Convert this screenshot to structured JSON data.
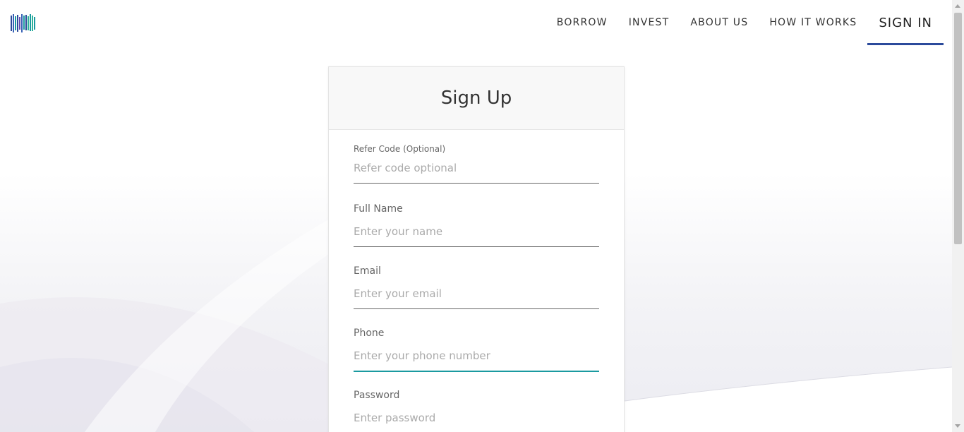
{
  "nav": {
    "items": [
      "BORROW",
      "INVEST",
      "ABOUT US",
      "HOW IT WORKS"
    ],
    "signin_label": "SIGN IN"
  },
  "logo": {
    "icon": "brand-logo-icon"
  },
  "signup": {
    "title": "Sign Up",
    "fields": [
      {
        "label": "Refer Code (Optional)",
        "placeholder": "Refer code optional",
        "value": ""
      },
      {
        "label": "Full Name",
        "placeholder": "Enter your name",
        "value": ""
      },
      {
        "label": "Email",
        "placeholder": "Enter your email",
        "value": ""
      },
      {
        "label": "Phone",
        "placeholder": "Enter your phone number",
        "value": ""
      },
      {
        "label": "Password",
        "placeholder": "Enter password",
        "value": ""
      }
    ]
  },
  "colors": {
    "accent": "#2b4a9b",
    "focus": "#1a9aa0",
    "text": "#333333",
    "placeholder": "#aaaaaa"
  }
}
